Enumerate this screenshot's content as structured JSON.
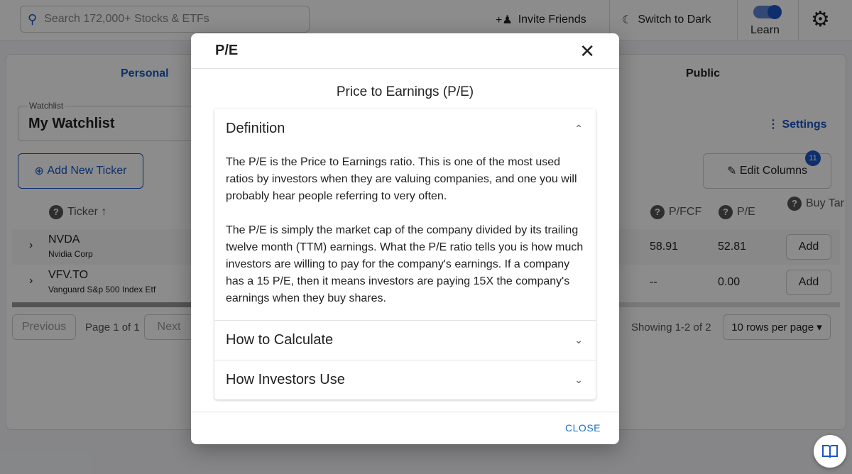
{
  "header": {
    "search_placeholder": "Search 172,000+ Stocks & ETFs",
    "invite": "Invite Friends",
    "dark": "Switch to Dark",
    "learn": "Learn",
    "learn_on": true
  },
  "tabs": [
    "Personal",
    "Public"
  ],
  "watchlist": {
    "label": "Watchlist",
    "value": "My Watchlist",
    "settings": "Settings",
    "add_ticker": "Add New Ticker",
    "edit_columns": "Edit Columns",
    "columns_badge": "11"
  },
  "table": {
    "headers": {
      "ticker": "Ticker ↑",
      "pfcf": "P/FCF",
      "pe": "P/E",
      "buy": "Buy Target"
    },
    "rows": [
      {
        "ticker": "NVDA",
        "name": "Nvidia Corp",
        "pfcf": "58.91",
        "pe": "52.81",
        "action": "Add"
      },
      {
        "ticker": "VFV.TO",
        "name": "Vanguard S&p 500 Index Etf",
        "pfcf": "--",
        "pe": "0.00",
        "action": "Add"
      }
    ]
  },
  "pagination": {
    "previous": "Previous",
    "page": "Page 1 of 1",
    "next": "Next",
    "showing": "Showing 1-2 of 2",
    "rows_per_page": "10 rows per page"
  },
  "modal": {
    "title": "P/E",
    "subtitle": "Price to Earnings (P/E)",
    "close": "CLOSE",
    "sections": [
      {
        "title": "Definition",
        "expanded": true,
        "paragraphs": [
          "The P/E is the Price to Earnings ratio. This is one of the most used ratios by investors when they are valuing companies, and one you will probably hear people referring to very often.",
          "The P/E is simply the market cap of the company divided by its trailing twelve month (TTM) earnings. What the P/E ratio tells you is how much investors are willing to pay for the company's earnings. If a company has a 15 P/E, then it means investors are paying 15X the company's earnings when they buy shares."
        ]
      },
      {
        "title": "How to Calculate",
        "expanded": false
      },
      {
        "title": "How Investors Use",
        "expanded": false
      }
    ]
  },
  "colors": {
    "accent": "#1a56c4",
    "link": "#1a73c8"
  }
}
